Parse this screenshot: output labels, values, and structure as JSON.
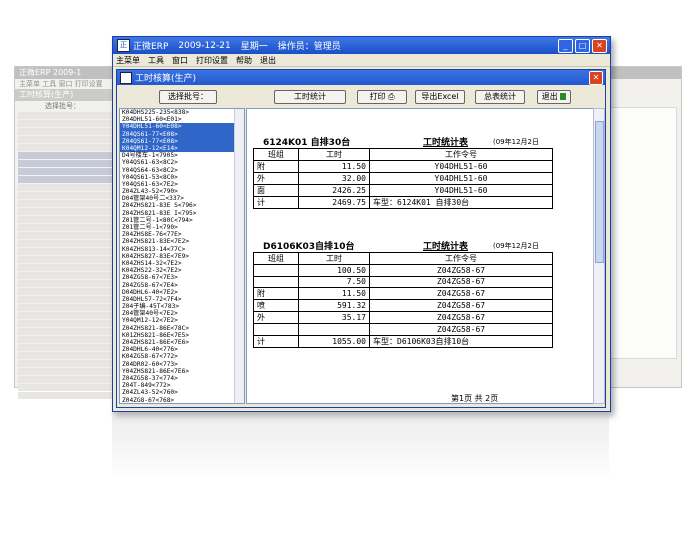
{
  "window": {
    "app_title": "正微ERP",
    "date": "2009-12-21",
    "weekday": "星期一",
    "operator": "操作员：管理员"
  },
  "menu": [
    "主菜单",
    "工具",
    "窗口",
    "打印设置",
    "帮助",
    "退出"
  ],
  "child_window": {
    "title": "工时核算(生产)"
  },
  "toolbar": {
    "select_batch": "选择批号：",
    "stat_hours": "工时统计",
    "print": "打印",
    "export_excel": "导出Excel",
    "summary": "总表统计",
    "exit": "退出"
  },
  "batch_list": [
    {
      "text": "K04DHS225-235<838>",
      "selected": false
    },
    {
      "text": "Z04DHL51-60<E01>",
      "selected": false
    },
    {
      "text": "Y04DHL51-60<E08>",
      "selected": true
    },
    {
      "text": "Z04QS61-77<E08>",
      "selected": true
    },
    {
      "text": "Z04QS61-77<E08>",
      "selected": true
    },
    {
      "text": "K04QM12-12<E14>",
      "selected": true
    },
    {
      "text": "D4号楼车-1<7905>",
      "selected": false
    },
    {
      "text": "Y04QS61-63<8C2>",
      "selected": false
    },
    {
      "text": "Y04QS64-63<8C2>",
      "selected": false
    },
    {
      "text": "Y04QS61-53<8C0>",
      "selected": false
    },
    {
      "text": "Y04QS61-63<7E2>",
      "selected": false
    },
    {
      "text": "Z04ZL43-52<790>",
      "selected": false
    },
    {
      "text": "D04管架40号二<337>",
      "selected": false
    },
    {
      "text": "Z04ZHS821-83E S<796>",
      "selected": false
    },
    {
      "text": "Z04ZHS821-83E I<795>",
      "selected": false
    },
    {
      "text": "Z01管二号-1<80C<794>",
      "selected": false
    },
    {
      "text": "Z01管二号-1<790>",
      "selected": false
    },
    {
      "text": "Z04ZHS8E-76<77E>",
      "selected": false
    },
    {
      "text": "Z04ZHS821-83E<7E2>",
      "selected": false
    },
    {
      "text": "K04ZHS813-14<77C>",
      "selected": false
    },
    {
      "text": "K04ZHS827-83E<7E9>",
      "selected": false
    },
    {
      "text": "K04ZHS14-32<7E2>",
      "selected": false
    },
    {
      "text": "K04ZHS22-32<7E2>",
      "selected": false
    },
    {
      "text": "Z04ZG58-67<7E3>",
      "selected": false
    },
    {
      "text": "Z04ZG58-67<7E4>",
      "selected": false
    },
    {
      "text": "D04DHL6-40<7E2>",
      "selected": false
    },
    {
      "text": "Z04DHL57-72<7F4>",
      "selected": false
    },
    {
      "text": "Z04子编-45T<783>",
      "selected": false
    },
    {
      "text": "Z04管架40号<7E2>",
      "selected": false
    },
    {
      "text": "Y04QM12-12<7E2>",
      "selected": false
    },
    {
      "text": "Z04ZHS821-86E<78C>",
      "selected": false
    },
    {
      "text": "K01ZHS821-86E<7E5>",
      "selected": false
    },
    {
      "text": "Z04ZHS821-86E<7E6>",
      "selected": false
    },
    {
      "text": "Z04DHL6-40<776>",
      "selected": false
    },
    {
      "text": "K04ZG58-67<772>",
      "selected": false
    },
    {
      "text": "Z04DR02-60<773>",
      "selected": false
    },
    {
      "text": "Y04ZHS821-86E<7E6>",
      "selected": false
    },
    {
      "text": "Z04ZG58-37<774>",
      "selected": false
    },
    {
      "text": "Z04T-849<772>",
      "selected": false
    },
    {
      "text": "Z04ZL43-52<760>",
      "selected": false
    },
    {
      "text": "Z04ZG8-67<768>",
      "selected": false
    },
    {
      "text": "Z04ZG58-37<774>",
      "selected": false
    }
  ],
  "report1": {
    "title": "6124K01  自排30台",
    "heading": "工时统计表",
    "date": "(09年12月2日",
    "headers": [
      "班组",
      "工时",
      "工作令号"
    ],
    "rows": [
      [
        "附",
        "11.50",
        "Y04DHL51-60"
      ],
      [
        "外",
        "32.00",
        "Y04DHL51-60"
      ],
      [
        "面",
        "2426.25",
        "Y04DHL51-60"
      ],
      [
        "计",
        "2469.75",
        "车型：6124K01 自排30台"
      ]
    ]
  },
  "report2": {
    "title": "D6106K03自排10台",
    "heading": "工时统计表",
    "date": "(09年12月2日",
    "headers": [
      "班组",
      "工时",
      "工作令号"
    ],
    "rows": [
      [
        "",
        "100.50",
        "Z04ZG58-67"
      ],
      [
        "",
        "7.50",
        "Z04ZG58-67"
      ],
      [
        "附",
        "11.50",
        "Z04ZG58-67"
      ],
      [
        "喷",
        "591.32",
        "Z04ZG58-67"
      ],
      [
        "外",
        "35.17",
        "Z04ZG58-67"
      ],
      [
        "",
        "",
        "Z04ZG58-67"
      ],
      [
        "计",
        "1055.00",
        "车型：D6106K03自排10台"
      ]
    ]
  },
  "footer": "第1页 共 2页",
  "background_window": {
    "app_title": "正微ERP",
    "date": "2009-1",
    "child_title": "工时核算(生产)",
    "select_batch": "选择批号："
  }
}
